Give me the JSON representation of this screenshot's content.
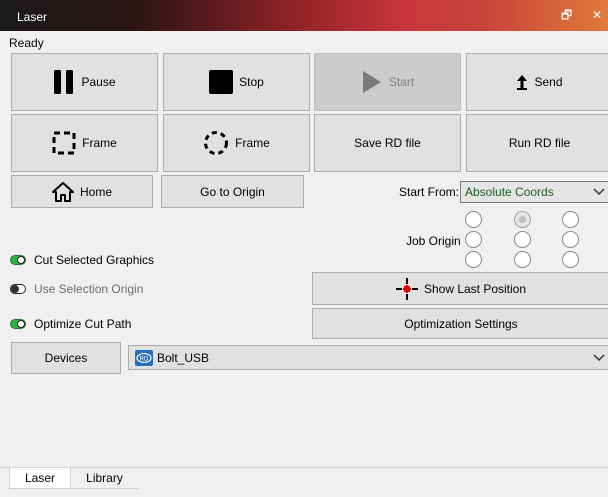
{
  "window": {
    "title": "Laser",
    "restore_glyph": "🗗",
    "close_glyph": "✕"
  },
  "status": "Ready",
  "buttons": {
    "pause": "Pause",
    "stop": "Stop",
    "start": "Start",
    "send": "Send",
    "frame_rect": "Frame",
    "frame_circle": "Frame",
    "save_rd": "Save RD file",
    "run_rd": "Run RD file",
    "home": "Home",
    "go_to_origin": "Go to Origin",
    "show_last_position": "Show Last Position",
    "optimization_settings": "Optimization Settings",
    "devices": "Devices"
  },
  "start_from": {
    "label": "Start From:",
    "value": "Absolute Coords"
  },
  "job_origin": {
    "label": "Job Origin",
    "selected_index": 1
  },
  "options": {
    "cut_selected": {
      "label": "Cut Selected Graphics",
      "enabled": true
    },
    "use_selection_origin": {
      "label": "Use Selection Origin",
      "enabled": false
    },
    "optimize_cut_path": {
      "label": "Optimize Cut Path",
      "enabled": true
    }
  },
  "device": {
    "name": "Bolt_USB"
  },
  "tabs": [
    {
      "label": "Laser",
      "active": true
    },
    {
      "label": "Library",
      "active": false
    }
  ],
  "colors": {
    "accent_green": "#2fb14a",
    "crosshair_red": "#e00000",
    "value_green": "#1f5c22"
  },
  "icons": {
    "pause": "pause-icon",
    "stop": "stop-icon",
    "start": "play-icon",
    "send": "upload-arrow-icon",
    "frame_rect": "dashed-square-icon",
    "frame_circle": "dashed-circle-icon",
    "home": "home-icon",
    "show_last_position": "crosshair-icon",
    "device": "rd-device-icon",
    "dropdown": "chevron-down-icon"
  }
}
